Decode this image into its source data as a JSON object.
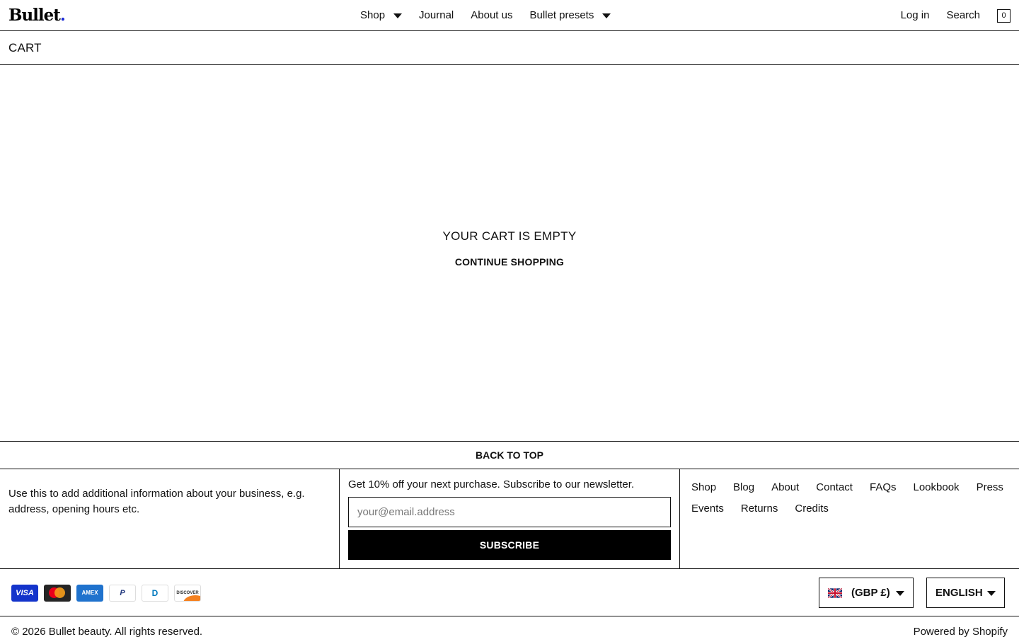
{
  "header": {
    "logo": "Bullet",
    "logo_dot": ".",
    "nav": [
      {
        "label": "Shop",
        "dropdown": true
      },
      {
        "label": "Journal",
        "dropdown": false
      },
      {
        "label": "About us",
        "dropdown": false
      },
      {
        "label": "Bullet presets",
        "dropdown": true
      }
    ],
    "login": "Log in",
    "search": "Search",
    "cart_count": "0"
  },
  "page": {
    "title": "CART",
    "empty_message": "YOUR CART IS EMPTY",
    "continue_label": "CONTINUE SHOPPING"
  },
  "footer": {
    "back_to_top": "BACK TO TOP",
    "info_text": "Use this to add additional information about your business, e.g. address, opening hours etc.",
    "newsletter_label": "Get 10% off your next purchase. Subscribe to our newsletter.",
    "email_placeholder": "your@email.address",
    "subscribe_label": "SUBSCRIBE",
    "links": [
      "Shop",
      "Blog",
      "About",
      "Contact",
      "FAQs",
      "Lookbook",
      "Press",
      "Events",
      "Returns",
      "Credits"
    ],
    "payments": {
      "visa": "VISA",
      "amex_top": "AM",
      "amex_bottom": "EX",
      "paypal": "P",
      "diners": "D",
      "discover": "DISCOVER"
    },
    "currency": "(GBP £)",
    "language": "ENGLISH",
    "copyright": "© 2026 Bullet beauty. All rights reserved.",
    "powered_by": "Powered by Shopify"
  },
  "colors": {
    "accent_dot": "#1b2bd6",
    "subscribe_bg": "#000000",
    "border": "#111111"
  }
}
